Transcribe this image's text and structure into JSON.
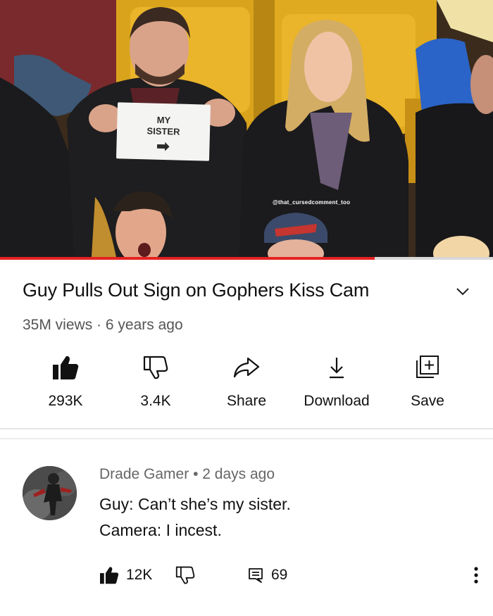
{
  "video": {
    "sign_line1": "MY",
    "sign_line2": "SISTER",
    "watermark": "@that_cursedcomment_too",
    "progress_fraction": 0.76,
    "title": "Guy Pulls Out Sign on Gophers Kiss Cam",
    "views": "35M views",
    "separator": "·",
    "age": "6 years ago"
  },
  "actions": {
    "like_count": "293K",
    "dislike_count": "3.4K",
    "share_label": "Share",
    "download_label": "Download",
    "save_label": "Save"
  },
  "comment": {
    "author": "Drade Gamer",
    "separator": "•",
    "age": "2 days ago",
    "line1": "Guy: Can’t she’s my sister.",
    "line2": "Camera: I incest.",
    "like_count": "12K",
    "reply_count": "69"
  },
  "colors": {
    "progress": "#e52222",
    "progress_track": "#d8d8d8",
    "text_primary": "#0f0f0f",
    "text_secondary": "#555555"
  },
  "icons": [
    "thumbs-up-filled-icon",
    "thumbs-down-icon",
    "share-arrow-icon",
    "download-icon",
    "save-playlist-icon",
    "chevron-down-icon",
    "reply-icon",
    "more-vert-icon"
  ]
}
